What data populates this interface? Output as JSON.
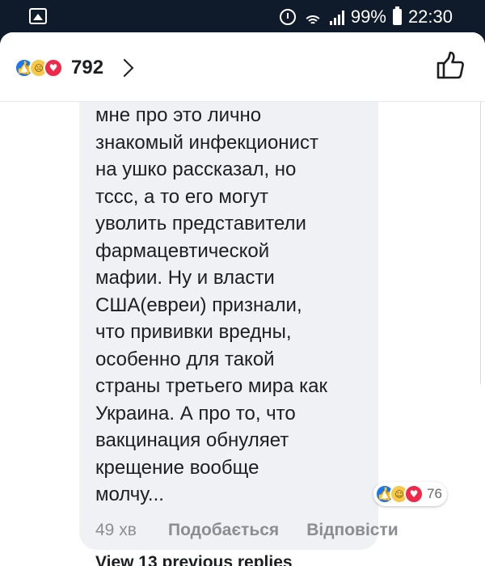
{
  "status_bar": {
    "battery": "99%",
    "time": "22:30",
    "icons": [
      "gallery-icon",
      "alarm-icon",
      "wifi-icon",
      "signal-icon",
      "battery-icon"
    ]
  },
  "header": {
    "reactions": [
      "like",
      "sad",
      "love"
    ],
    "count": "792",
    "icons": [
      "chevron-right-icon",
      "thumbs-up-outline-icon"
    ]
  },
  "comment": {
    "text": "мне про это лично\nзнакомый инфекционист\nна ушко рассказал, но\nтссс, а то его могут\nуволить представители\nфармацевтической\nмафии. Ну и власти\nСША(евреи) признали,\nчто прививки вредны,\nособенно для такой\nстраны третьего мира как\nУкраина. А про то, что\nвакцинация обнуляет\nкрещение вообще\nмолчу...",
    "reactions": [
      "like",
      "haha",
      "love"
    ],
    "reaction_count": "76",
    "time": "49 хв",
    "like_label": "Подобається",
    "reply_label": "Відповісти",
    "view_previous": "View 13 previous replies"
  },
  "colors": {
    "status_bg": "#0f1b2b",
    "bubble_bg": "#eff1f4",
    "like_blue": "#1877f2",
    "love_red": "#f02849",
    "secondary_text": "#8a8d91"
  }
}
